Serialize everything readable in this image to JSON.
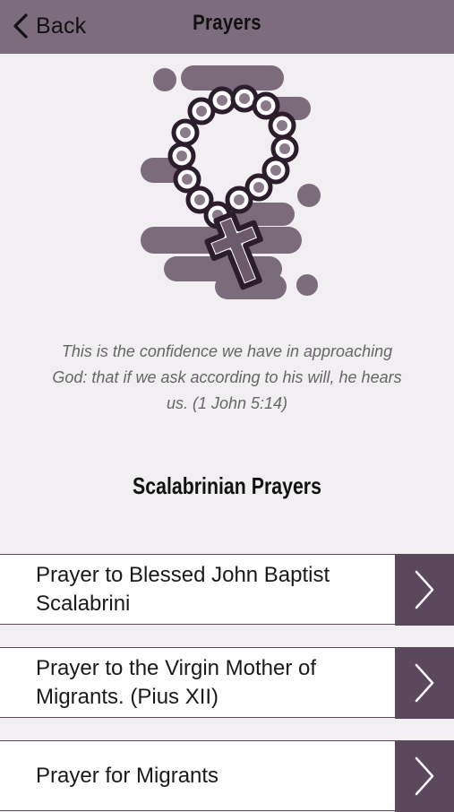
{
  "nav": {
    "back_label": "Back",
    "title": "Prayers"
  },
  "quote": "This is the confidence we have in approaching God: that if we ask according to his will, he hears us. (1 John 5:14)",
  "section_title": "Scalabrinian Prayers",
  "prayers": [
    {
      "label": "Prayer to Blessed John Baptist Scalabrini"
    },
    {
      "label": "Prayer to the Virgin Mother of Migrants. (Pius XII)"
    },
    {
      "label": "Prayer for Migrants"
    }
  ],
  "colors": {
    "nav_background": "#7d6c7d",
    "page_background": "#f1eff1",
    "accent": "#5c485c",
    "blob": "#7b6b7b"
  },
  "icons": {
    "back": "chevron-left-icon",
    "illustration": "rosary-icon",
    "row_arrow": "chevron-right-icon"
  }
}
